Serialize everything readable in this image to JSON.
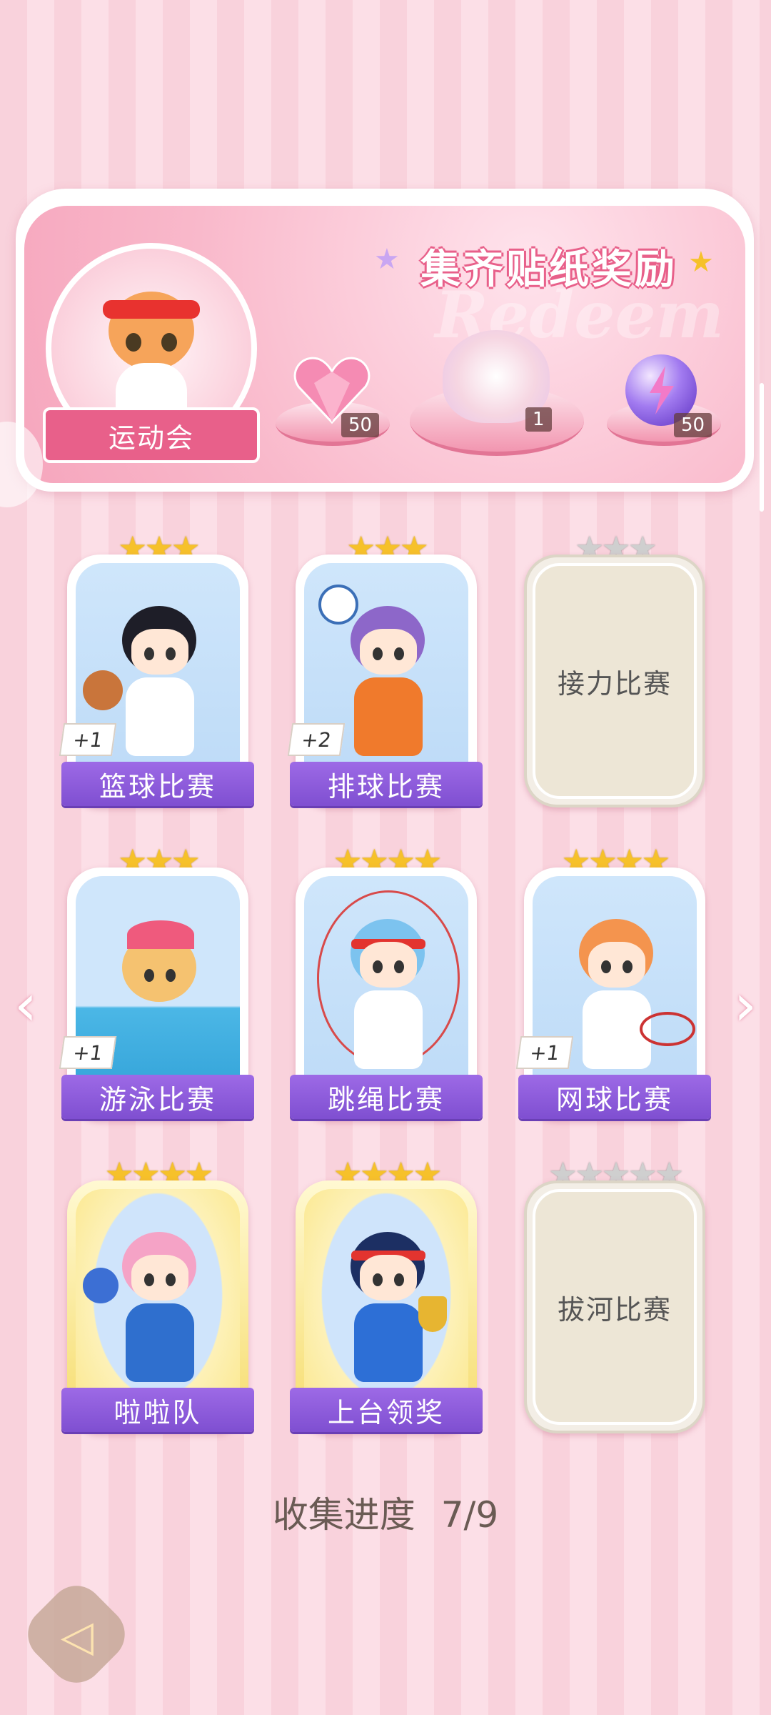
{
  "banner": {
    "title": "集齐贴纸奖励",
    "watermark": "Redeem",
    "event_label": "运动会",
    "rewards": [
      {
        "icon": "heart-gem-icon",
        "count": "50"
      },
      {
        "icon": "bouquet-icon",
        "count": "1"
      },
      {
        "icon": "lightning-orb-icon",
        "count": "50"
      }
    ]
  },
  "cards": [
    {
      "name": "篮球比赛",
      "stars": 3,
      "max_stars": 3,
      "bonus": "+1",
      "collected": true
    },
    {
      "name": "排球比赛",
      "stars": 3,
      "max_stars": 3,
      "bonus": "+2",
      "collected": true
    },
    {
      "name": "接力比赛",
      "stars": 0,
      "max_stars": 3,
      "bonus": "",
      "collected": false
    },
    {
      "name": "游泳比赛",
      "stars": 3,
      "max_stars": 3,
      "bonus": "+1",
      "collected": true
    },
    {
      "name": "跳绳比赛",
      "stars": 4,
      "max_stars": 4,
      "bonus": "",
      "collected": true
    },
    {
      "name": "网球比赛",
      "stars": 4,
      "max_stars": 4,
      "bonus": "+1",
      "collected": true
    },
    {
      "name": "啦啦队",
      "stars": 4,
      "max_stars": 4,
      "bonus": "",
      "collected": true
    },
    {
      "name": "上台领奖",
      "stars": 4,
      "max_stars": 4,
      "bonus": "",
      "collected": true
    },
    {
      "name": "拔河比赛",
      "stars": 0,
      "max_stars": 5,
      "bonus": "",
      "collected": false
    }
  ],
  "progress": {
    "label": "收集进度",
    "value": "7/9"
  },
  "colors": {
    "ribbon": "#8a5bdb",
    "star_gold": "#f6c12a",
    "star_grey": "#cfcfcf",
    "banner_title_outline": "#e8608a"
  }
}
